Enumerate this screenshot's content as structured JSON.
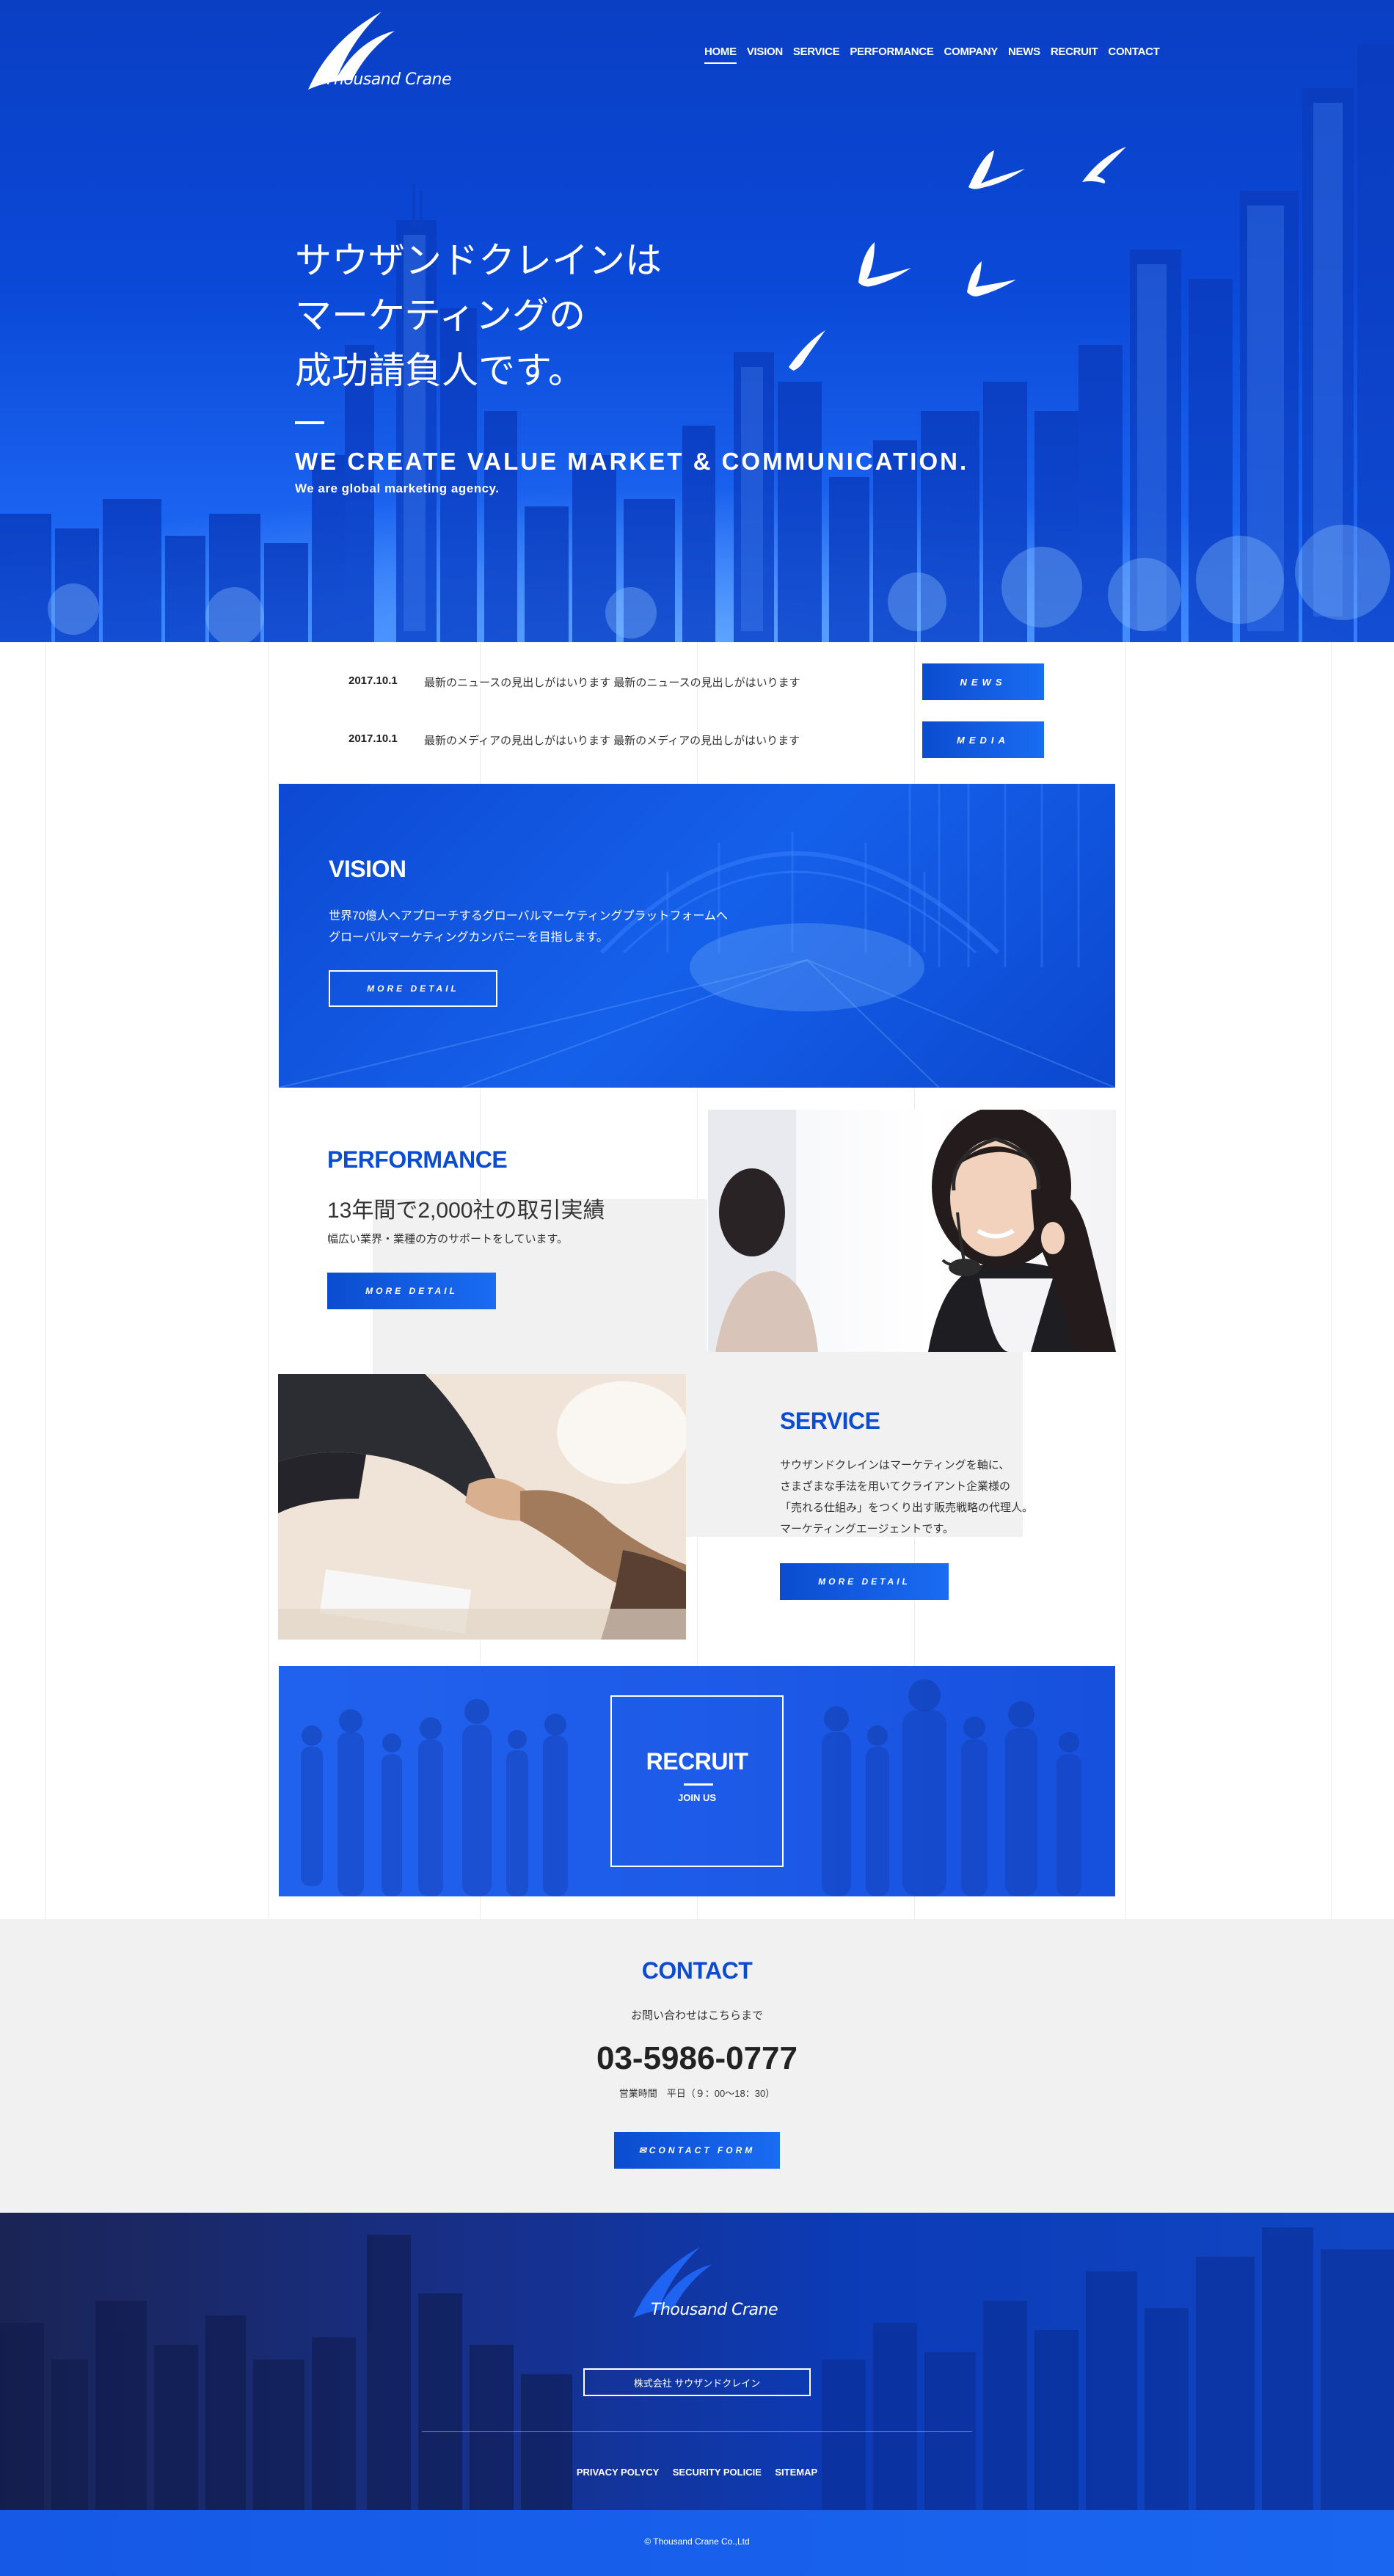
{
  "brand": {
    "name": "Thousand Crane"
  },
  "nav": {
    "items": [
      "HOME",
      "VISION",
      "SERVICE",
      "PERFORMANCE",
      "COMPANY",
      "NEWS",
      "RECRUIT",
      "CONTACT"
    ],
    "active": "HOME"
  },
  "hero": {
    "title_lines": [
      "サウザンドクレインは",
      "マーケティングの",
      "成功請負人です。"
    ],
    "tagline": "WE CREATE VALUE MARKET & COMMUNICATION.",
    "subtagline": "We are global marketing agency."
  },
  "news": [
    {
      "date": "2017.10.1",
      "text": "最新のニュースの見出しがはいります 最新のニュースの見出しがはいります",
      "button": "NEWS"
    },
    {
      "date": "2017.10.1",
      "text": "最新のメディアの見出しがはいります 最新のメディアの見出しがはいります",
      "button": "MEDIA"
    }
  ],
  "vision": {
    "title": "VISION",
    "body_lines": [
      "世界70億人へアプローチするグローバルマーケティングプラットフォームへ",
      "グローバルマーケティングカンパニーを目指します。"
    ],
    "button": "MORE DETAIL"
  },
  "performance": {
    "title": "PERFORMANCE",
    "heading": "13年間で2,000社の取引実績",
    "body": "幅広い業界・業種の方のサポートをしています。",
    "button": "MORE DETAIL"
  },
  "service": {
    "title": "SERVICE",
    "body_lines": [
      "サウザンドクレインはマーケティングを軸に、",
      "さまざまな手法を用いてクライアント企業様の",
      "「売れる仕組み」をつくり出す販売戦略の代理人。",
      "マーケティングエージェントです。"
    ],
    "button": "MORE DETAIL"
  },
  "recruit": {
    "title": "RECRUIT",
    "subtitle": "JOIN US"
  },
  "contact": {
    "title": "CONTACT",
    "lead": "お問い合わせはこちらまで",
    "phone": "03-5986-0777",
    "hours": "営業時間　平日（９：00〜18：30）",
    "button": "✉CONTACT FORM"
  },
  "footer": {
    "company_button": "株式会社 サウザンドクレイン",
    "links": [
      "PRIVACY POLYCY",
      "SECURITY POLICIE",
      "SITEMAP"
    ],
    "copyright": "© Thousand Crane Co.,Ltd"
  },
  "colors": {
    "brand_blue": "#0b4cd0",
    "bright_blue": "#1a6cf2",
    "light_grey": "#f1f1f1",
    "footer_navy": "#1b2455"
  }
}
